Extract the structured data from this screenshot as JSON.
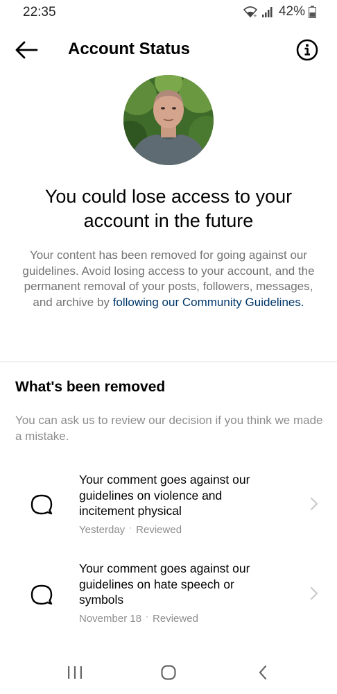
{
  "status_bar": {
    "time": "22:35",
    "battery": "42%",
    "icons": [
      "wifi-icon",
      "signal-icon",
      "battery-icon"
    ]
  },
  "header": {
    "title": "Account Status",
    "back_icon": "arrow-left-icon",
    "info_icon": "info-icon"
  },
  "warning": {
    "title": "You could lose access to your account in the future",
    "body": "Your content has been removed for going against our guidelines. Avoid losing access to your account, and the permanent removal of your posts, followers, messages, and archive by",
    "link": "following our Community Guidelines",
    "body_end": "."
  },
  "removed": {
    "title": "What's been removed",
    "subtitle": "You can ask us to review our decision if you think we made a mistake.",
    "items": [
      {
        "text": "Your comment goes against our guidelines on violence and incitement physical",
        "date": "Yesterday",
        "status": "Reviewed",
        "icon": "comment-icon"
      },
      {
        "text": "Your comment goes against our guidelines on hate speech or symbols",
        "date": "November 18",
        "status": "Reviewed",
        "icon": "comment-icon"
      }
    ]
  },
  "colors": {
    "link": "#00376b",
    "secondary_text": "#8e8e8e",
    "divider": "#dbdbdb"
  }
}
